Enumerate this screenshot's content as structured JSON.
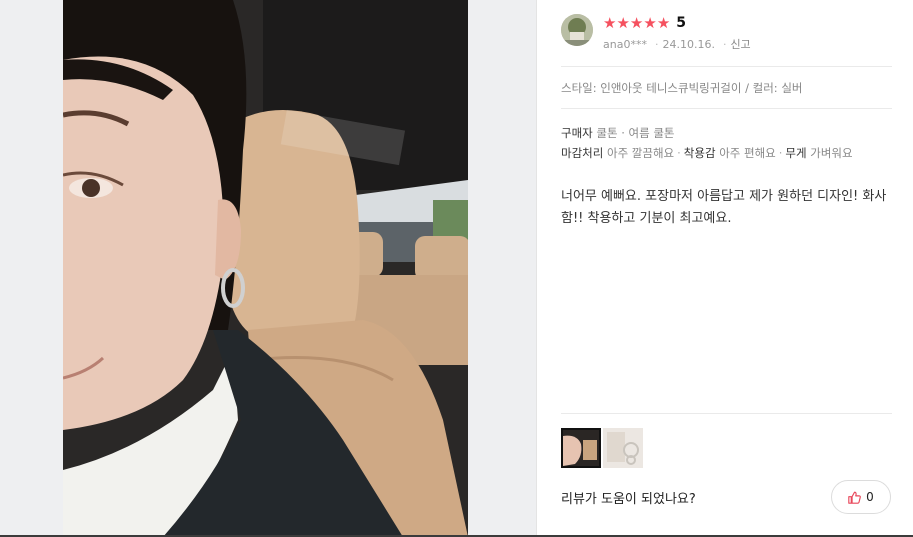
{
  "review": {
    "rating_stars": 5,
    "score": "5",
    "reviewer": "ana0***",
    "date": "24.10.16.",
    "report_label": "신고",
    "option_label": "스타일: 인앤아웃 테니스큐빅링귀걸이 / 컬러: 실버",
    "attributes": [
      {
        "name": "구매자",
        "value": "쿨톤 · 여름 쿨톤"
      },
      {
        "name": "마감처리",
        "value": "아주 깔끔해요"
      },
      {
        "name": "착용감",
        "value": "아주 편해요"
      },
      {
        "name": "무게",
        "value": "가벼워요"
      }
    ],
    "body": "너어무 예뻐요. 포장마저 아름답고 제가 원하던 디자인! 화사함!! 착용하고 기분이 최고예요.",
    "helpful_question": "리뷰가 도움이 되었나요?",
    "like_count": "0"
  },
  "colors": {
    "star": "#f5515f",
    "gutter": "#eeeff1",
    "like_icon": "#e8475a"
  },
  "icons": {
    "star": "star-icon",
    "like": "thumbs-up-icon"
  }
}
